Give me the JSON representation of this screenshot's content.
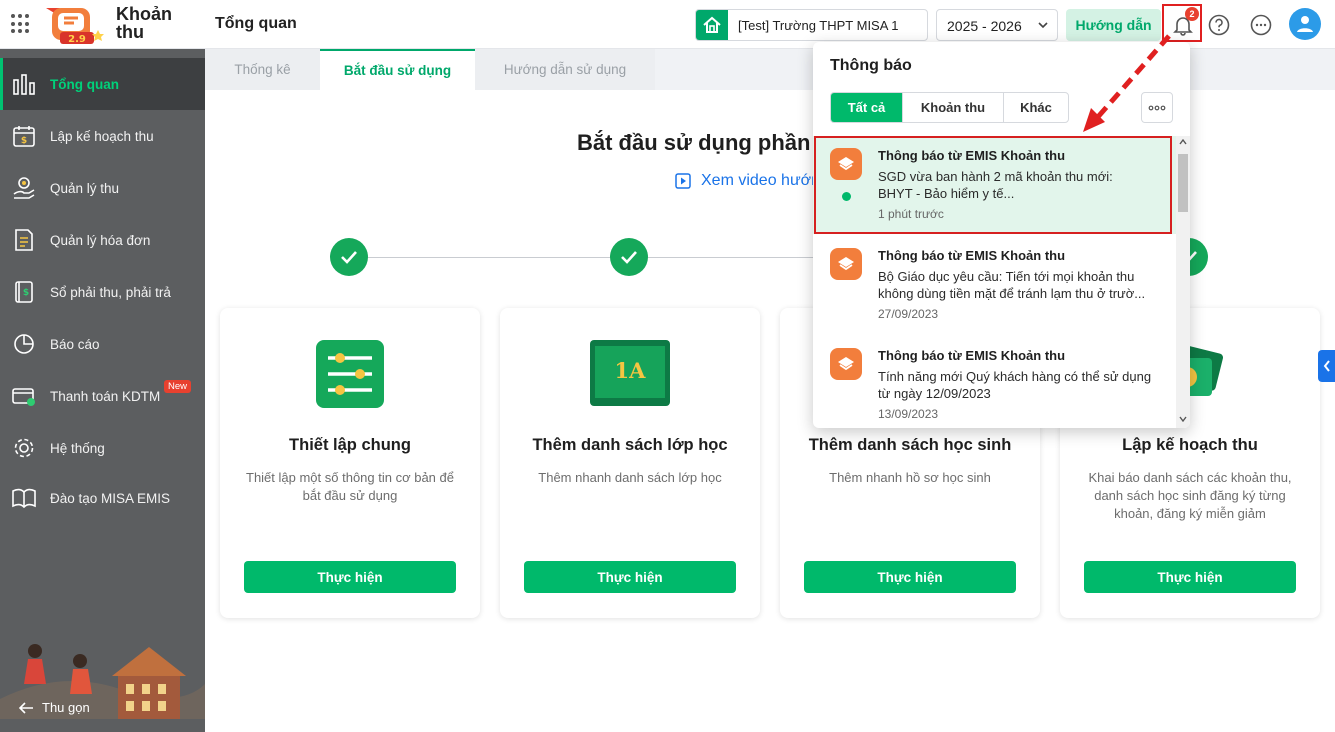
{
  "header": {
    "app_name": "Khoản thu",
    "page_title": "Tổng quan",
    "school": "[Test] Trường THPT MISA 1",
    "year": "2025 - 2026",
    "guide_label": "Hướng dẫn",
    "notification_count": "2"
  },
  "sidebar": {
    "items": [
      {
        "label": "Tổng quan",
        "icon": "chart-bars-icon"
      },
      {
        "label": "Lập kế hoạch thu",
        "icon": "calendar-money-icon"
      },
      {
        "label": "Quản lý thu",
        "icon": "hand-coin-icon"
      },
      {
        "label": "Quản lý hóa đơn",
        "icon": "document-icon"
      },
      {
        "label": "Sổ phải thu, phải trả",
        "icon": "ledger-icon"
      },
      {
        "label": "Báo cáo",
        "icon": "pie-chart-icon"
      },
      {
        "label": "Thanh toán KDTM",
        "icon": "card-payment-icon"
      },
      {
        "label": "Hệ thống",
        "icon": "gear-icon"
      },
      {
        "label": "Đào tạo MISA EMIS",
        "icon": "book-icon"
      }
    ],
    "new_badge": "New",
    "collapse_label": "Thu gọn"
  },
  "tabs": [
    {
      "label": "Thống kê"
    },
    {
      "label": "Bắt đầu sử dụng"
    },
    {
      "label": "Hướng dẫn sử dụng"
    }
  ],
  "main": {
    "title": "Bắt đầu sử dụng phần mềm",
    "video_link": "Xem video hướng dẫn",
    "cards": [
      {
        "title": "Thiết lập chung",
        "desc": "Thiết lập một số thông tin cơ bản để bắt đầu sử dụng",
        "button": "Thực hiện"
      },
      {
        "title": "Thêm danh sách lớp học",
        "desc": "Thêm nhanh danh sách lớp học",
        "button": "Thực hiện",
        "icon_text": "1A"
      },
      {
        "title": "Thêm danh sách học sinh",
        "desc": "Thêm nhanh hồ sơ học sinh",
        "button": "Thực hiện"
      },
      {
        "title": "Lập kế hoạch thu",
        "desc": "Khai báo danh sách các khoản thu, danh sách học sinh đăng ký từng khoản, đăng ký miễn giảm",
        "button": "Thực hiện"
      }
    ]
  },
  "notifications": {
    "title": "Thông báo",
    "tabs": [
      "Tất cả",
      "Khoản thu",
      "Khác"
    ],
    "items": [
      {
        "title": "Thông báo từ EMIS Khoản thu",
        "body_line1": "SGD vừa ban hành 2 mã khoản thu mới:",
        "body_line2": "BHYT - Bảo hiểm y tế...",
        "time": "1 phút trước",
        "unread": true
      },
      {
        "title": "Thông báo từ EMIS Khoản thu",
        "body_line1": "Bộ Giáo dục yêu cầu: Tiến tới mọi khoản thu",
        "body_line2": "không dùng tiền mặt để tránh lạm thu ở trườ...",
        "time": "27/09/2023",
        "unread": false
      },
      {
        "title": "Thông báo từ EMIS Khoản thu",
        "body_line1": "Tính năng mới Quý khách hàng có thể sử dụng",
        "body_line2": "từ ngày 12/09/2023",
        "time": "13/09/2023",
        "unread": false
      }
    ]
  },
  "colors": {
    "accent": "#00b96b",
    "sidebar": "#5c5e60",
    "highlight_border": "#d62020"
  }
}
